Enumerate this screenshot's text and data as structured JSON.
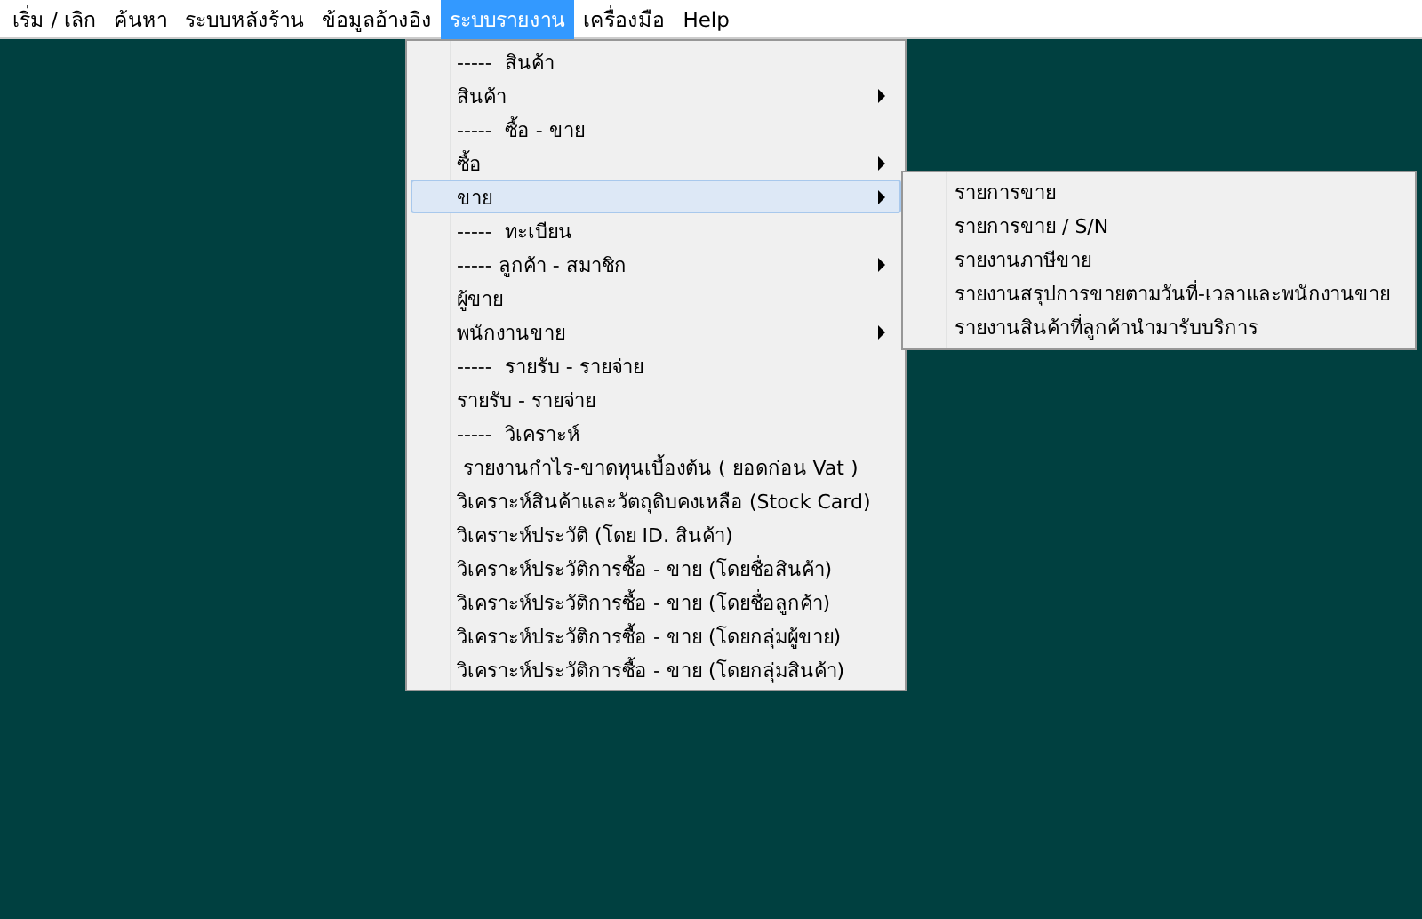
{
  "menu_bar": [
    {
      "label": "เริ่ม / เลิก",
      "selected": false
    },
    {
      "label": "ค้นหา",
      "selected": false
    },
    {
      "label": "ระบบหลังร้าน",
      "selected": false
    },
    {
      "label": "ข้อมูลอ้างอิง",
      "selected": false
    },
    {
      "label": "ระบบรายงาน",
      "selected": true
    },
    {
      "label": "เครื่องมือ",
      "selected": false
    },
    {
      "label": "Help",
      "selected": false
    }
  ],
  "dropdown": {
    "items": [
      {
        "label": "-----  สินค้า",
        "selected": false,
        "submenu": false
      },
      {
        "label": "สินค้า",
        "selected": false,
        "submenu": true
      },
      {
        "label": "-----  ซื้อ - ขาย",
        "selected": false,
        "submenu": false
      },
      {
        "label": "ซื้อ",
        "selected": false,
        "submenu": true
      },
      {
        "label": "ขาย",
        "selected": true,
        "submenu": true
      },
      {
        "label": "-----  ทะเบียน",
        "selected": false,
        "submenu": false
      },
      {
        "label": "----- ลูกค้า - สมาชิก",
        "selected": false,
        "submenu": true
      },
      {
        "label": "ผู้ขาย",
        "selected": false,
        "submenu": false
      },
      {
        "label": "พนักงานขาย",
        "selected": false,
        "submenu": true
      },
      {
        "label": "-----  รายรับ - รายจ่าย",
        "selected": false,
        "submenu": false
      },
      {
        "label": "รายรับ - รายจ่าย",
        "selected": false,
        "submenu": false
      },
      {
        "label": "-----  วิเคราะห์",
        "selected": false,
        "submenu": false
      },
      {
        "label": " รายงานกำไร-ขาดทุนเบื้องต้น ( ยอดก่อน Vat )",
        "selected": false,
        "submenu": false
      },
      {
        "label": "วิเคราะห์สินค้าและวัตถุดิบคงเหลือ (Stock Card)",
        "selected": false,
        "submenu": false
      },
      {
        "label": "วิเคราะห์ประวัติ (โดย ID. สินค้า)",
        "selected": false,
        "submenu": false
      },
      {
        "label": "วิเคราะห์ประวัติการซื้อ - ขาย (โดยชื่อสินค้า)",
        "selected": false,
        "submenu": false
      },
      {
        "label": "วิเคราะห์ประวัติการซื้อ - ขาย (โดยชื่อลูกค้า)",
        "selected": false,
        "submenu": false
      },
      {
        "label": "วิเคราะห์ประวัติการซื้อ - ขาย (โดยกลุ่มผู้ขาย)",
        "selected": false,
        "submenu": false
      },
      {
        "label": "วิเคราะห์ประวัติการซื้อ - ขาย (โดยกลุ่มสินค้า)",
        "selected": false,
        "submenu": false
      }
    ]
  },
  "submenu": {
    "items": [
      {
        "label": "รายการขาย"
      },
      {
        "label": "รายการขาย / S/N"
      },
      {
        "label": "รายงานภาษีขาย"
      },
      {
        "label": "รายงานสรุปการขายตามวันที่-เวลาและพนักงานขาย"
      },
      {
        "label": "รายงานสินค้าที่ลูกค้านำมารับบริการ"
      }
    ]
  }
}
